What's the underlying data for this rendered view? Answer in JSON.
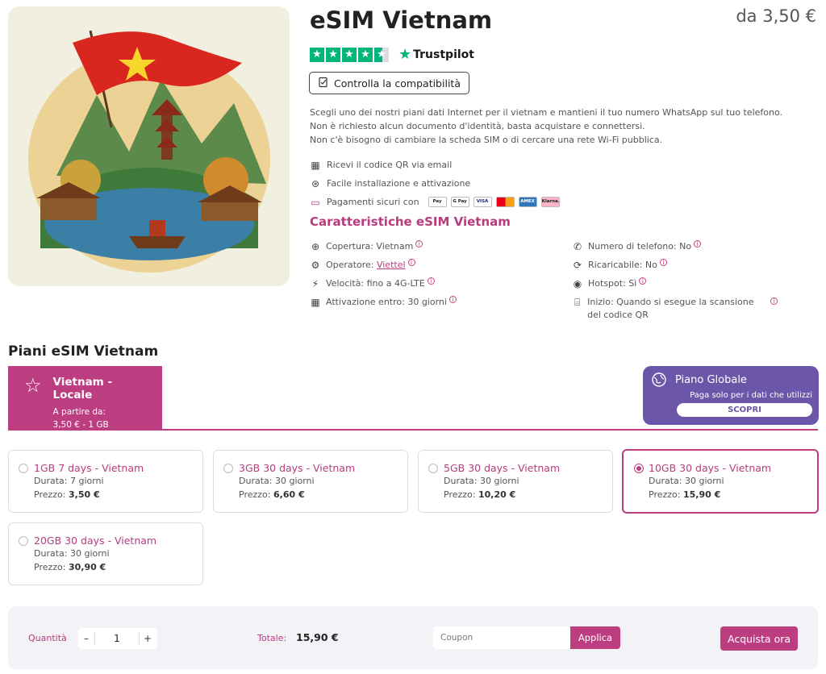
{
  "product": {
    "title": "eSIM Vietnam",
    "price_from": "da 3,50 €",
    "rating": {
      "stars": 4.5,
      "brand": "Trustpilot"
    },
    "compat_button": "Controlla la compatibilità",
    "description": [
      "Scegli uno dei nostri piani dati Internet per il vietnam e mantieni il tuo numero WhatsApp sul tuo telefono.",
      "Non è richiesto alcun documento d'identità, basta acquistare e connettersi.",
      "Non c'è bisogno di cambiare la scheda SIM o di cercare una rete Wi-Fi pubblica."
    ],
    "benefits": [
      {
        "icon": "qr-code-icon",
        "text": "Ricevi il codice QR via email"
      },
      {
        "icon": "click-icon",
        "text": "Facile installazione e attivazione"
      },
      {
        "icon": "secure-payment-icon",
        "text": "Pagamenti sicuri con"
      }
    ],
    "payment_methods": [
      "Pay",
      "G Pay",
      "VISA",
      "",
      "AMEX",
      "Klarna."
    ]
  },
  "features": {
    "title": "Caratteristiche eSIM Vietnam",
    "items": [
      {
        "icon": "globe-icon",
        "label": "Copertura: Vietnam",
        "link": ""
      },
      {
        "icon": "gear-icon",
        "label": "Operatore:",
        "link": "Viettel"
      },
      {
        "icon": "signal-icon",
        "label": "Velocità: fino a 4G-LTE",
        "link": ""
      },
      {
        "icon": "calendar-icon",
        "label": "Attivazione entro: 30 giorni",
        "link": ""
      },
      {
        "icon": "phone-icon",
        "label": "Numero di telefono: No",
        "link": ""
      },
      {
        "icon": "recharge-icon",
        "label": "Ricaricabile: No",
        "link": ""
      },
      {
        "icon": "hotspot-icon",
        "label": "Hotspot: Sì",
        "link": ""
      },
      {
        "icon": "scan-icon",
        "label": "Inizio: Quando si esegue la scansione del codice QR",
        "link": ""
      }
    ],
    "info_mark": "i"
  },
  "plans": {
    "title": "Piani eSIM Vietnam",
    "local_tab": {
      "title": "Vietnam - Locale",
      "line1": "A partire da:",
      "line2": "3,50 € - 1 GB"
    },
    "global_tab": {
      "title": "Piano Globale",
      "subtitle": "Paga solo per i dati che utilizzi",
      "button": "SCOPRI"
    },
    "duration_label": "Durata:",
    "price_label": "Prezzo:",
    "items": [
      {
        "name": "1GB 7 days - Vietnam",
        "duration": "7 giorni",
        "price": "3,50 €",
        "selected": false
      },
      {
        "name": "3GB 30 days - Vietnam",
        "duration": "30 giorni",
        "price": "6,60 €",
        "selected": false
      },
      {
        "name": "5GB 30 days - Vietnam",
        "duration": "30 giorni",
        "price": "10,20 €",
        "selected": false
      },
      {
        "name": "10GB 30 days - Vietnam",
        "duration": "30 giorni",
        "price": "15,90 €",
        "selected": true
      },
      {
        "name": "20GB 30 days - Vietnam",
        "duration": "30 giorni",
        "price": "30,90 €",
        "selected": false
      }
    ]
  },
  "checkout": {
    "quantity_label": "Quantità",
    "minus": "–",
    "plus": "+",
    "quantity": "1",
    "total_label": "Totale:",
    "total": "15,90 €",
    "coupon_placeholder": "Coupon",
    "apply": "Applica",
    "buy": "Acquista ora"
  },
  "colors": {
    "accent": "#bc3e80",
    "global": "#6b56a9",
    "trustpilot": "#00b67a"
  }
}
